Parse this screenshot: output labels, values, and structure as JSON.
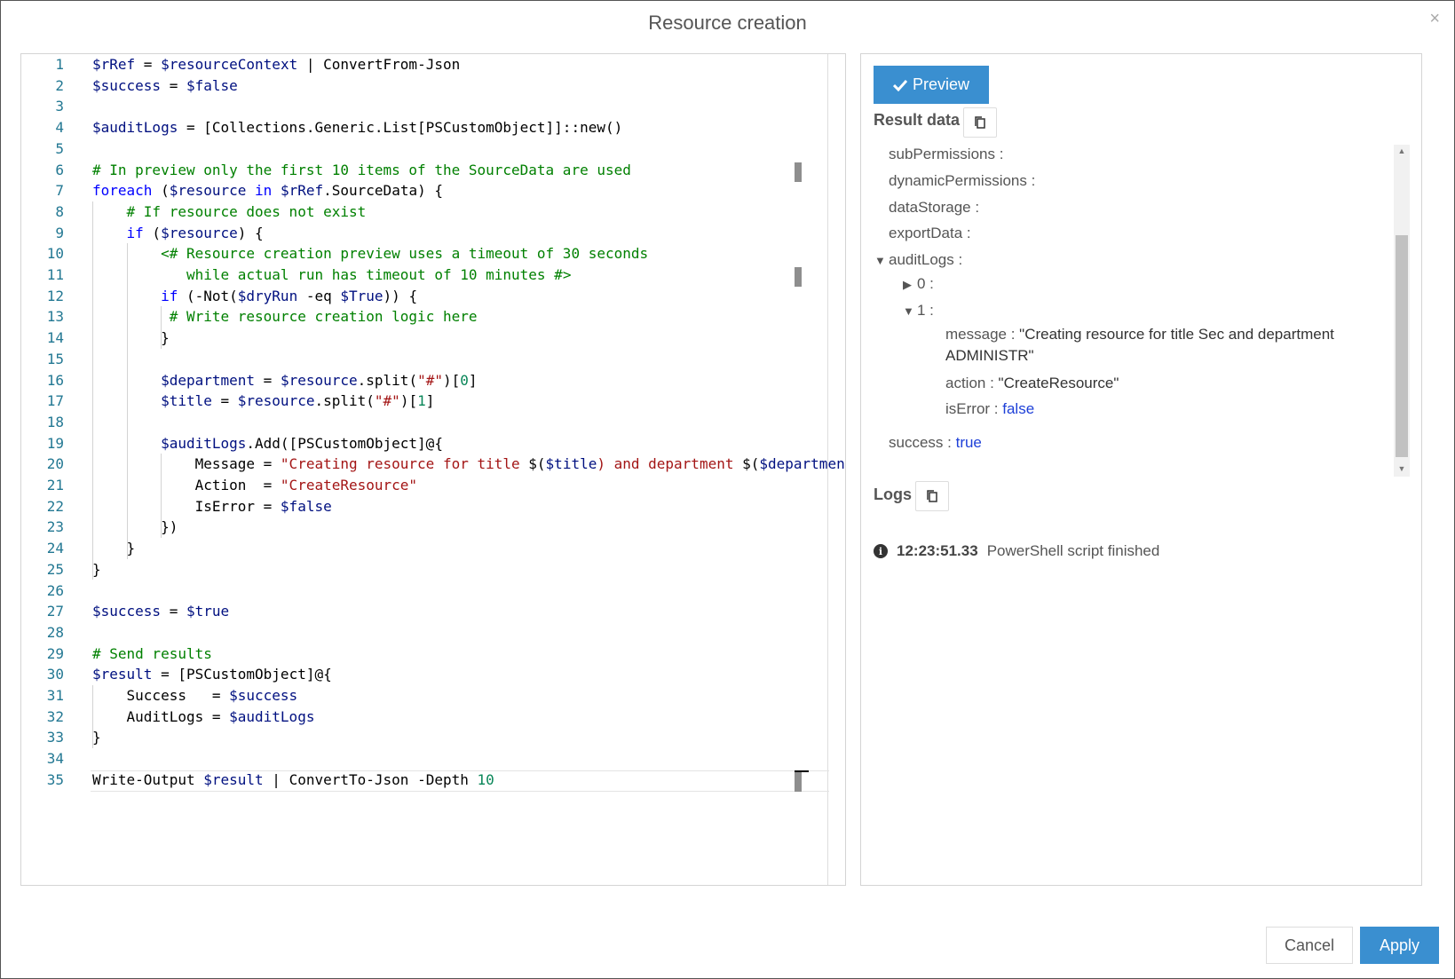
{
  "dialog": {
    "title": "Resource creation",
    "close_glyph": "×",
    "close_icon": "close-icon"
  },
  "editor": {
    "lines": [
      {
        "n": "1",
        "tokens": [
          [
            "var",
            "$rRef"
          ],
          [
            "txt",
            " = "
          ],
          [
            "var",
            "$resourceContext"
          ],
          [
            "txt",
            " | ConvertFrom-Json"
          ]
        ]
      },
      {
        "n": "2",
        "tokens": [
          [
            "var",
            "$success"
          ],
          [
            "txt",
            " = "
          ],
          [
            "var",
            "$false"
          ]
        ]
      },
      {
        "n": "3",
        "tokens": []
      },
      {
        "n": "4",
        "tokens": [
          [
            "var",
            "$auditLogs"
          ],
          [
            "txt",
            " = [Collections.Generic.List[PSCustomObject]]::new()"
          ]
        ]
      },
      {
        "n": "5",
        "tokens": []
      },
      {
        "n": "6",
        "tokens": [
          [
            "cmt",
            "# In preview only the first 10 items of the SourceData are used"
          ]
        ]
      },
      {
        "n": "7",
        "tokens": [
          [
            "kw",
            "foreach"
          ],
          [
            "txt",
            " ("
          ],
          [
            "var",
            "$resource"
          ],
          [
            "txt",
            " "
          ],
          [
            "kw",
            "in"
          ],
          [
            "txt",
            " "
          ],
          [
            "var",
            "$rRef"
          ],
          [
            "txt",
            ".SourceData) {"
          ]
        ]
      },
      {
        "n": "8",
        "tokens": [
          [
            "txt",
            "    "
          ],
          [
            "cmt",
            "# If resource does not exist"
          ]
        ]
      },
      {
        "n": "9",
        "tokens": [
          [
            "txt",
            "    "
          ],
          [
            "kw",
            "if"
          ],
          [
            "txt",
            " ("
          ],
          [
            "var",
            "$resource"
          ],
          [
            "txt",
            ") {"
          ]
        ]
      },
      {
        "n": "10",
        "tokens": [
          [
            "txt",
            "        "
          ],
          [
            "cmt",
            "<# Resource creation preview uses a timeout of 30 seconds"
          ]
        ]
      },
      {
        "n": "11",
        "tokens": [
          [
            "txt",
            "           "
          ],
          [
            "cmt",
            "while actual run has timeout of 10 minutes #>"
          ]
        ]
      },
      {
        "n": "12",
        "tokens": [
          [
            "txt",
            "        "
          ],
          [
            "kw",
            "if"
          ],
          [
            "txt",
            " (-Not("
          ],
          [
            "var",
            "$dryRun"
          ],
          [
            "txt",
            " -eq "
          ],
          [
            "var",
            "$True"
          ],
          [
            "txt",
            ")) {"
          ]
        ]
      },
      {
        "n": "13",
        "tokens": [
          [
            "txt",
            "         "
          ],
          [
            "cmt",
            "# Write resource creation logic here"
          ]
        ]
      },
      {
        "n": "14",
        "tokens": [
          [
            "txt",
            "        }"
          ]
        ]
      },
      {
        "n": "15",
        "tokens": []
      },
      {
        "n": "16",
        "tokens": [
          [
            "txt",
            "        "
          ],
          [
            "var",
            "$department"
          ],
          [
            "txt",
            " = "
          ],
          [
            "var",
            "$resource"
          ],
          [
            "txt",
            ".split("
          ],
          [
            "str",
            "\"#\""
          ],
          [
            "txt",
            ")["
          ],
          [
            "num",
            "0"
          ],
          [
            "txt",
            "]"
          ]
        ]
      },
      {
        "n": "17",
        "tokens": [
          [
            "txt",
            "        "
          ],
          [
            "var",
            "$title"
          ],
          [
            "txt",
            " = "
          ],
          [
            "var",
            "$resource"
          ],
          [
            "txt",
            ".split("
          ],
          [
            "str",
            "\"#\""
          ],
          [
            "txt",
            ")["
          ],
          [
            "num",
            "1"
          ],
          [
            "txt",
            "]"
          ]
        ]
      },
      {
        "n": "18",
        "tokens": []
      },
      {
        "n": "19",
        "tokens": [
          [
            "txt",
            "        "
          ],
          [
            "var",
            "$auditLogs"
          ],
          [
            "txt",
            ".Add([PSCustomObject]@{"
          ]
        ]
      },
      {
        "n": "20",
        "tokens": [
          [
            "txt",
            "            Message = "
          ],
          [
            "str",
            "\"Creating resource for title "
          ],
          [
            "txt",
            "$("
          ],
          [
            "var",
            "$title"
          ],
          [
            "str",
            ") and department "
          ],
          [
            "txt",
            "$("
          ],
          [
            "var",
            "$departmen"
          ]
        ]
      },
      {
        "n": "21",
        "tokens": [
          [
            "txt",
            "            Action  = "
          ],
          [
            "str",
            "\"CreateResource\""
          ]
        ]
      },
      {
        "n": "22",
        "tokens": [
          [
            "txt",
            "            IsError = "
          ],
          [
            "var",
            "$false"
          ]
        ]
      },
      {
        "n": "23",
        "tokens": [
          [
            "txt",
            "        })"
          ]
        ]
      },
      {
        "n": "24",
        "tokens": [
          [
            "txt",
            "    }"
          ]
        ]
      },
      {
        "n": "25",
        "tokens": [
          [
            "txt",
            "}"
          ]
        ]
      },
      {
        "n": "26",
        "tokens": []
      },
      {
        "n": "27",
        "tokens": [
          [
            "var",
            "$success"
          ],
          [
            "txt",
            " = "
          ],
          [
            "var",
            "$true"
          ]
        ]
      },
      {
        "n": "28",
        "tokens": []
      },
      {
        "n": "29",
        "tokens": [
          [
            "cmt",
            "# Send results"
          ]
        ]
      },
      {
        "n": "30",
        "tokens": [
          [
            "var",
            "$result"
          ],
          [
            "txt",
            " = [PSCustomObject]@{"
          ]
        ]
      },
      {
        "n": "31",
        "tokens": [
          [
            "txt",
            "    Success   = "
          ],
          [
            "var",
            "$success"
          ]
        ]
      },
      {
        "n": "32",
        "tokens": [
          [
            "txt",
            "    AuditLogs = "
          ],
          [
            "var",
            "$auditLogs"
          ]
        ]
      },
      {
        "n": "33",
        "tokens": [
          [
            "txt",
            "}"
          ]
        ]
      },
      {
        "n": "34",
        "tokens": []
      },
      {
        "n": "35",
        "tokens": [
          [
            "txt",
            "Write-Output "
          ],
          [
            "var",
            "$result"
          ],
          [
            "txt",
            " | ConvertTo-Json -Depth "
          ],
          [
            "num",
            "10"
          ]
        ]
      }
    ]
  },
  "panel": {
    "preview_label": "Preview",
    "preview_icon": "check-icon",
    "result_data_label": "Result data",
    "logs_label": "Logs",
    "copy_icon": "copy-icon",
    "tree": [
      {
        "indent": 0,
        "caret": "",
        "key": "subPermissions",
        "sep": " :",
        "value": "",
        "vtype": ""
      },
      {
        "indent": 0,
        "caret": "",
        "key": "dynamicPermissions",
        "sep": " :",
        "value": "",
        "vtype": ""
      },
      {
        "indent": 0,
        "caret": "",
        "key": "dataStorage",
        "sep": " :",
        "value": "",
        "vtype": ""
      },
      {
        "indent": 0,
        "caret": "",
        "key": "exportData",
        "sep": " :",
        "value": "",
        "vtype": ""
      },
      {
        "indent": 0,
        "caret": "▼",
        "key": "auditLogs",
        "sep": " :",
        "value": "",
        "vtype": ""
      },
      {
        "indent": 1,
        "caret": "▶",
        "key": "0",
        "sep": " :",
        "value": "",
        "vtype": ""
      },
      {
        "indent": 1,
        "caret": "▼",
        "key": "1",
        "sep": " :",
        "value": "",
        "vtype": ""
      },
      {
        "indent": 2,
        "caret": "",
        "key": "message",
        "sep": " : ",
        "value": "\"Creating resource for title Sec and department",
        "vtype": "str"
      },
      {
        "indent": 2,
        "caret": "",
        "key": "",
        "sep": "",
        "value": "ADMINISTR\"",
        "vtype": "str"
      },
      {
        "indent": 2,
        "caret": "",
        "key": "action",
        "sep": " : ",
        "value": "\"CreateResource\"",
        "vtype": "str"
      },
      {
        "indent": 2,
        "caret": "",
        "key": "isError",
        "sep": " : ",
        "value": "false",
        "vtype": "bool"
      },
      {
        "indent": 0,
        "caret": "",
        "key": "success",
        "sep": " : ",
        "value": "true",
        "vtype": "bool"
      }
    ],
    "log": {
      "icon": "info-icon",
      "icon_glyph": "i",
      "time": "12:23:51.33",
      "message": "PowerShell script finished"
    }
  },
  "footer": {
    "cancel_label": "Cancel",
    "apply_label": "Apply"
  },
  "colors": {
    "accent": "#3a8fd0",
    "code_var": "#001080",
    "code_comment": "#008000",
    "code_keyword": "#0000ff",
    "code_string": "#a31515",
    "code_number": "#098658",
    "bool_value": "#1e40d8"
  }
}
